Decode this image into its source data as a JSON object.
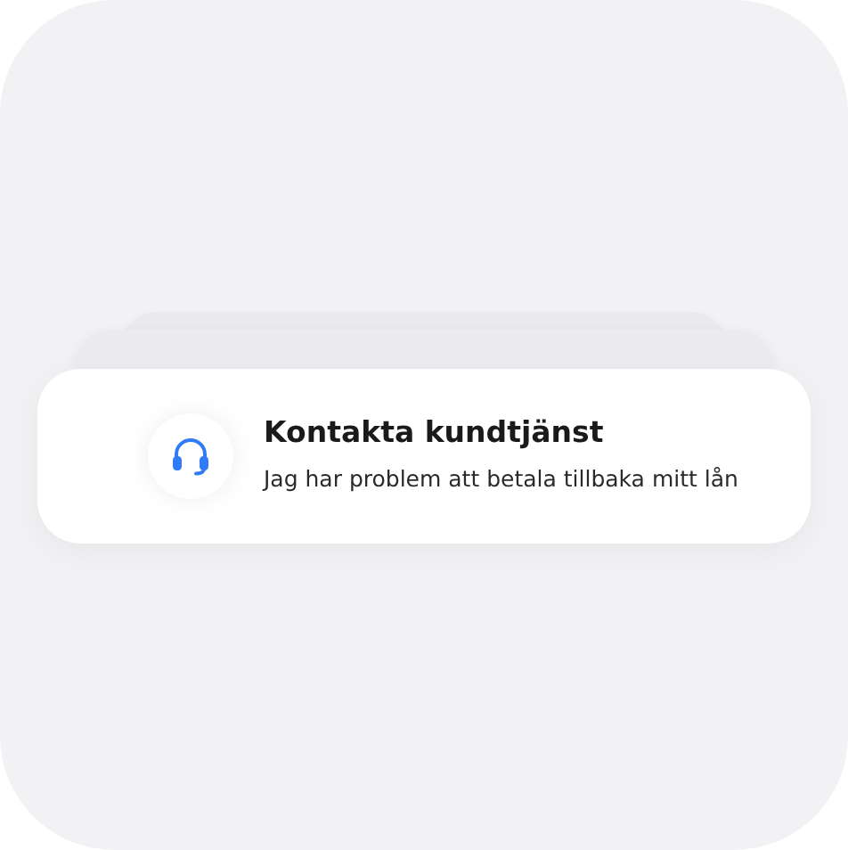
{
  "card": {
    "title": "Kontakta kundtjänst",
    "subtitle": "Jag har problem att betala tillbaka mitt lån"
  }
}
